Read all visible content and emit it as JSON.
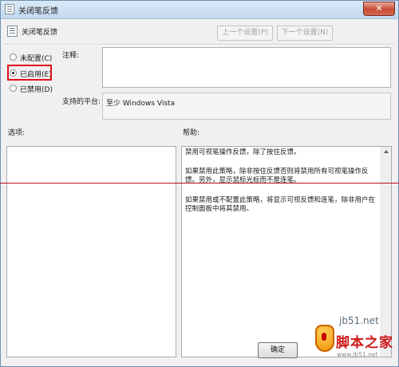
{
  "window": {
    "title": "关闭笔反馈",
    "close_label": "✕"
  },
  "header": {
    "policy_name": "关闭笔反馈",
    "prev_label": "上一个设置(P)",
    "next_label": "下一个设置(N)"
  },
  "state": {
    "options": [
      {
        "label": "未配置(C)",
        "selected": false
      },
      {
        "label": "已启用(E)",
        "selected": true
      },
      {
        "label": "已禁用(D)",
        "selected": false
      }
    ]
  },
  "comment": {
    "label": "注释:",
    "value": ""
  },
  "platform": {
    "label": "支持的平台:",
    "value": "至少 Windows Vista"
  },
  "options_section": {
    "label": "选项:"
  },
  "help_section": {
    "label": "帮助:",
    "paragraphs": [
      "禁用可视笔操作反馈，除了按住反馈。",
      "如果禁用此策略，除非按住反馈否则将禁用所有可视笔操作反馈。另外，显示鼠标光标而不是连笔。",
      "如果禁用或不配置此策略，将显示可视反馈和连笔，除非用户在控制面板中将其禁用。"
    ]
  },
  "footer": {
    "ok_label": "确定"
  },
  "watermark": {
    "domain": "jb51.net",
    "cn_text": "脚本之家",
    "en_text": "www.Jb51.net"
  },
  "colors": {
    "annotation_red": "#e0121c",
    "title_bar": "#c2d8ef"
  }
}
